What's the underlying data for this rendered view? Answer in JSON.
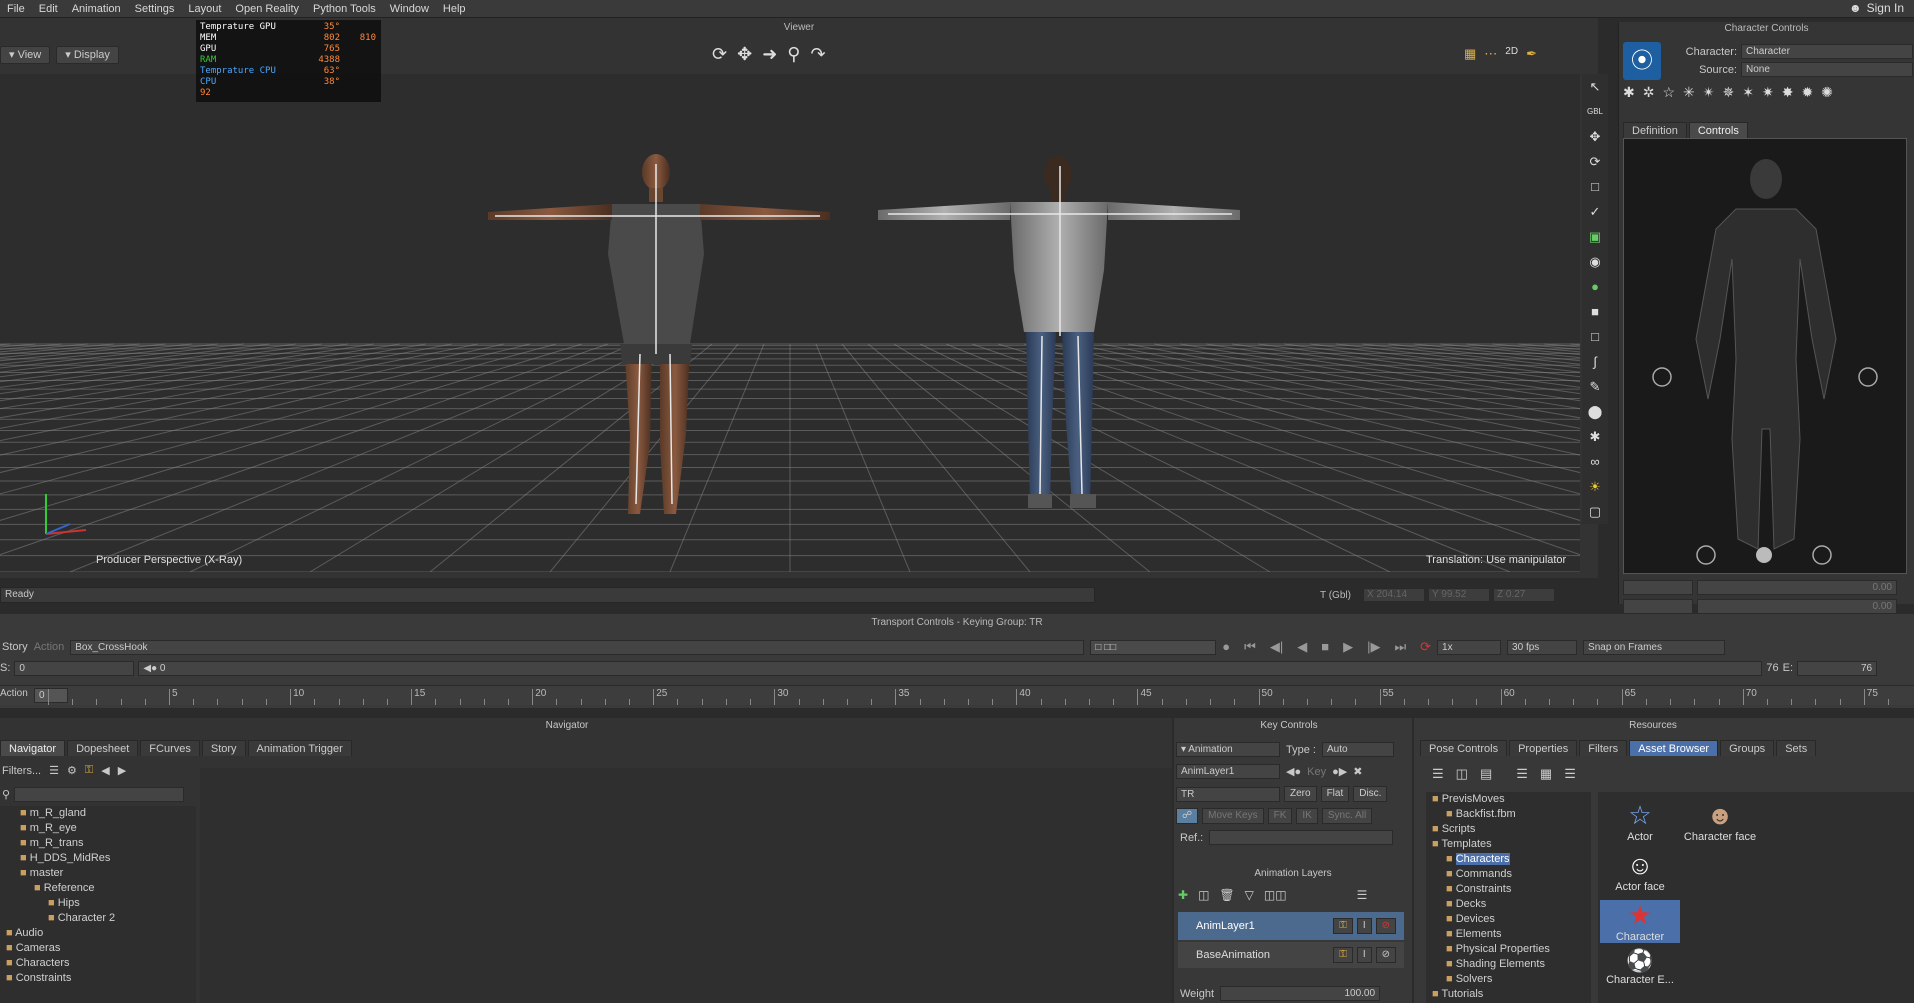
{
  "menu": [
    "File",
    "Edit",
    "Animation",
    "Settings",
    "Layout",
    "Open Reality",
    "Python Tools",
    "Window",
    "Help"
  ],
  "signin": "Sign In",
  "viewer": {
    "title": "Viewer",
    "view_btn": "View",
    "display_btn": "Display",
    "perspective_label": "Producer Perspective (X-Ray)",
    "manipulator_label": "Translation: Use manipulator",
    "hud": [
      {
        "k": "Temprature GPU",
        "v": "35°",
        "v2": ""
      },
      {
        "k": "MEM",
        "v": "802",
        "v2": "810"
      },
      {
        "k": "GPU",
        "v": "765",
        "v2": ""
      },
      {
        "k": "RAM",
        "v": "4388",
        "v2": ""
      },
      {
        "k": "Temprature  CPU",
        "v": "63°",
        "v2": ""
      },
      {
        "k": "CPU",
        "v": "38°",
        "v2": ""
      },
      {
        "k": "92",
        "v": "",
        "v2": ""
      }
    ],
    "status": "Ready",
    "coord_label": "T (Gbl)",
    "coords": [
      {
        "axis": "X",
        "value": "204.14"
      },
      {
        "axis": "Y",
        "value": "99.52"
      },
      {
        "axis": "Z",
        "value": "0.27"
      }
    ]
  },
  "character_controls": {
    "title": "Character Controls",
    "character_label": "Character:",
    "character_value": "Character",
    "source_label": "Source:",
    "source_value": "None",
    "tabs": [
      "Definition",
      "Controls"
    ],
    "slider1": "0.00",
    "slider2": "0.00"
  },
  "transport": {
    "title": "Transport Controls  -  Keying Group: TR",
    "story_label": "Story",
    "action_label": "Action",
    "take": "Box_CrossHook",
    "speed": "1x",
    "fps": "30 fps",
    "snap": "Snap on Frames",
    "start_label": "S:",
    "start": "0",
    "current": "0",
    "end_current": "76",
    "end_label": "E:",
    "end": "76",
    "action_row_label": "Action",
    "frame_box": "0",
    "ticks": [
      "5",
      "10",
      "15",
      "20",
      "25",
      "30",
      "35",
      "40",
      "45",
      "50",
      "55",
      "60",
      "65",
      "70",
      "75"
    ]
  },
  "navigator": {
    "title": "Navigator",
    "tabs": [
      "Navigator",
      "Dopesheet",
      "FCurves",
      "Story",
      "Animation Trigger"
    ],
    "filters": "Filters...",
    "tree": [
      {
        "label": "m_R_gland",
        "indent": 1
      },
      {
        "label": "m_R_eye",
        "indent": 1
      },
      {
        "label": "m_R_trans",
        "indent": 1
      },
      {
        "label": "H_DDS_MidRes",
        "indent": 1
      },
      {
        "label": "master",
        "indent": 1
      },
      {
        "label": "Reference",
        "indent": 2
      },
      {
        "label": "Hips",
        "indent": 3
      },
      {
        "label": "Character 2",
        "indent": 3
      },
      {
        "label": "Audio",
        "indent": 0
      },
      {
        "label": "Cameras",
        "indent": 0
      },
      {
        "label": "Characters",
        "indent": 0
      },
      {
        "label": "Constraints",
        "indent": 0
      }
    ]
  },
  "key_controls": {
    "title": "Key Controls",
    "animation_btn": "Animation",
    "type_label": "Type :",
    "type_value": "Auto",
    "layer": "AnimLayer1",
    "key_btn": "Key",
    "group": "TR",
    "zero": "Zero",
    "flat": "Flat",
    "disc": "Disc.",
    "move_keys": "Move Keys",
    "fk": "FK",
    "ik": "IK",
    "sync": "Sync. All",
    "ref_label": "Ref.:",
    "layers_title": "Animation Layers",
    "layers": [
      "AnimLayer1",
      "BaseAnimation"
    ],
    "weight_label": "Weight",
    "weight_value": "100.00"
  },
  "resources": {
    "title": "Resources",
    "tabs": [
      "Pose Controls",
      "Properties",
      "Filters",
      "Asset Browser",
      "Groups",
      "Sets"
    ],
    "tree": [
      {
        "label": "PrevisMoves",
        "indent": 0
      },
      {
        "label": "Backfist.fbm",
        "indent": 1
      },
      {
        "label": "Scripts",
        "indent": 0
      },
      {
        "label": "Templates",
        "indent": 0
      },
      {
        "label": "Characters",
        "indent": 1
      },
      {
        "label": "Commands",
        "indent": 1
      },
      {
        "label": "Constraints",
        "indent": 1
      },
      {
        "label": "Decks",
        "indent": 1
      },
      {
        "label": "Devices",
        "indent": 1
      },
      {
        "label": "Elements",
        "indent": 1
      },
      {
        "label": "Physical Properties",
        "indent": 1
      },
      {
        "label": "Shading Elements",
        "indent": 1
      },
      {
        "label": "Solvers",
        "indent": 1
      },
      {
        "label": "Tutorials",
        "indent": 0
      }
    ],
    "assets": [
      "Actor",
      "Character face",
      "Actor face",
      "Character",
      "Character E..."
    ]
  }
}
